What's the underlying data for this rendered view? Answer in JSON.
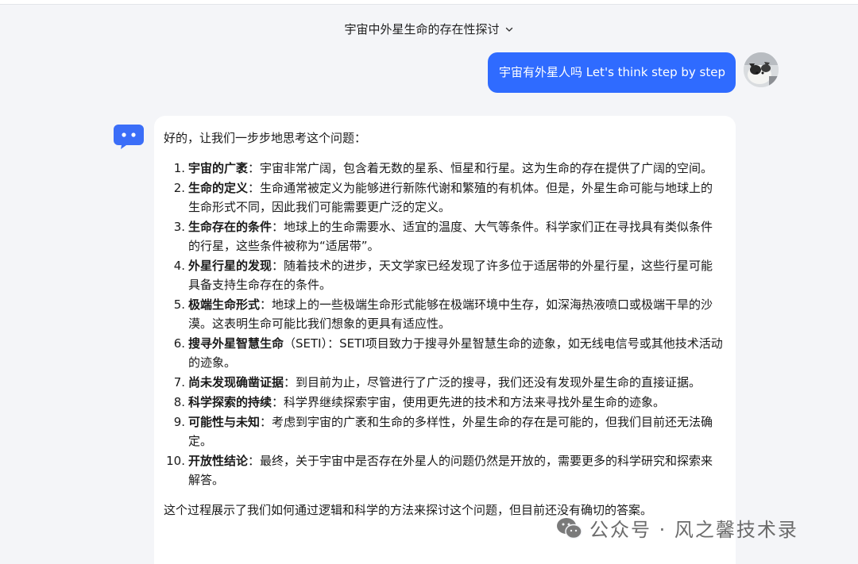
{
  "header": {
    "conversation_title": "宇宙中外星生命的存在性探讨",
    "dropdown_icon": "chevron-down-icon"
  },
  "user_message": {
    "text": "宇宙有外星人吗 Let's think step by step",
    "avatar_icon": "cat-avatar"
  },
  "assistant_message": {
    "bot_icon": "robot-icon",
    "intro": "好的，让我们一步步地思考这个问题：",
    "items": [
      {
        "num": "1.",
        "title": "宇宙的广袤",
        "sep": "：",
        "body": "宇宙非常广阔，包含着无数的星系、恒星和行星。这为生命的存在提供了广阔的空间。"
      },
      {
        "num": "2.",
        "title": "生命的定义",
        "sep": "：",
        "body": "生命通常被定义为能够进行新陈代谢和繁殖的有机体。但是，外星生命可能与地球上的生命形式不同，因此我们可能需要更广泛的定义。"
      },
      {
        "num": "3.",
        "title": "生命存在的条件",
        "sep": "：",
        "body": "地球上的生命需要水、适宜的温度、大气等条件。科学家们正在寻找具有类似条件的行星，这些条件被称为“适居带”。"
      },
      {
        "num": "4.",
        "title": "外星行星的发现",
        "sep": "：",
        "body": "随着技术的进步，天文学家已经发现了许多位于适居带的外星行星，这些行星可能具备支持生命存在的条件。"
      },
      {
        "num": "5.",
        "title": "极端生命形式",
        "sep": "：",
        "body": "地球上的一些极端生命形式能够在极端环境中生存，如深海热液喷口或极端干旱的沙漠。这表明生命可能比我们想象的更具有适应性。"
      },
      {
        "num": "6.",
        "title": "搜寻外星智慧生命",
        "sep": "（SETI）：",
        "body": "SETI项目致力于搜寻外星智慧生命的迹象，如无线电信号或其他技术活动的迹象。"
      },
      {
        "num": "7.",
        "title": "尚未发现确凿证据",
        "sep": "：",
        "body": "到目前为止，尽管进行了广泛的搜寻，我们还没有发现外星生命的直接证据。"
      },
      {
        "num": "8.",
        "title": "科学探索的持续",
        "sep": "：",
        "body": "科学界继续探索宇宙，使用更先进的技术和方法来寻找外星生命的迹象。"
      },
      {
        "num": "9.",
        "title": "可能性与未知",
        "sep": "：",
        "body": "考虑到宇宙的广袤和生命的多样性，外星生命的存在是可能的，但我们目前还无法确定。"
      },
      {
        "num": "10.",
        "title": "开放性结论",
        "sep": "：",
        "body": "最终，关于宇宙中是否存在外星人的问题仍然是开放的，需要更多的科学研究和探索来解答。"
      }
    ],
    "outro": "这个过程展示了我们如何通过逻辑和科学的方法来探讨这个问题，但目前还没有确切的答案。"
  },
  "watermark": {
    "text": "公众号 · 风之馨技术录",
    "icon": "wechat-icon"
  }
}
